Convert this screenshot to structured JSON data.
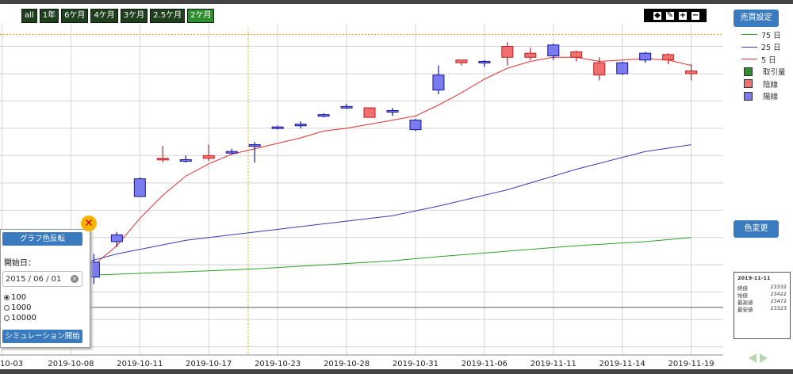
{
  "range_buttons": [
    "all",
    "1年",
    "6ケ月",
    "4ケ月",
    "3ケ月",
    "2.5ケ月",
    "2ケ月"
  ],
  "active_range": "2ケ月",
  "side_buttons": {
    "trade_settings": "売買設定",
    "color_change": "色変更"
  },
  "legend": [
    {
      "label": "75 日",
      "kind": "line",
      "color": "#2ca02c"
    },
    {
      "label": "25 日",
      "kind": "line",
      "color": "#3a3ab0"
    },
    {
      "label": "5 日",
      "kind": "line",
      "color": "#e03030"
    },
    {
      "label": "取引量",
      "kind": "box",
      "color": "#2e8b2e"
    },
    {
      "label": "陰線",
      "kind": "box",
      "color": "#f07070"
    },
    {
      "label": "陽線",
      "kind": "box",
      "color": "#7b7bf0"
    }
  ],
  "tooltip": {
    "date": "2019-11-11",
    "rows": [
      {
        "label": "終値",
        "value": "23332"
      },
      {
        "label": "始値",
        "value": "23422"
      },
      {
        "label": "最高値",
        "value": "23472"
      },
      {
        "label": "最安値",
        "value": "23323"
      }
    ]
  },
  "simulation_panel": {
    "flip_button": "グラフ色反転",
    "start_label": "開始日：",
    "start_date": "2015 / 06 / 01",
    "options": [
      "100",
      "1000",
      "10000"
    ],
    "selected_option": "100",
    "start_button": "シミュレーション開始"
  },
  "chart_data": {
    "type": "candlestick",
    "x_tick_labels": [
      "10-03",
      "2019-10-08",
      "2019-10-11",
      "2019-10-17",
      "2019-10-23",
      "2019-10-28",
      "2019-10-31",
      "2019-11-06",
      "2019-11-11",
      "2019-11-14",
      "2019-11-19"
    ],
    "candles": [
      {
        "i": 2,
        "open": 21760,
        "close": 21765,
        "high": 21780,
        "low": 21740,
        "kind": "yang"
      },
      {
        "i": 3,
        "open": 21610,
        "close": 21690,
        "high": 21700,
        "low": 21590,
        "kind": "yang"
      },
      {
        "i": 4,
        "open": 21610,
        "close": 21720,
        "high": 21780,
        "low": 21560,
        "kind": "yang"
      },
      {
        "i": 5,
        "open": 21870,
        "close": 21920,
        "high": 21940,
        "low": 21830,
        "kind": "yang"
      },
      {
        "i": 6,
        "open": 22200,
        "close": 22330,
        "high": 22340,
        "low": 22200,
        "kind": "yang"
      },
      {
        "i": 7,
        "open": 22480,
        "close": 22470,
        "high": 22570,
        "low": 22450,
        "kind": "yin"
      },
      {
        "i": 8,
        "open": 22460,
        "close": 22470,
        "high": 22500,
        "low": 22450,
        "kind": "yang"
      },
      {
        "i": 9,
        "open": 22500,
        "close": 22480,
        "high": 22580,
        "low": 22460,
        "kind": "yin"
      },
      {
        "i": 10,
        "open": 22520,
        "close": 22530,
        "high": 22550,
        "low": 22510,
        "kind": "yang"
      },
      {
        "i": 11,
        "open": 22570,
        "close": 22580,
        "high": 22600,
        "low": 22450,
        "kind": "yang"
      },
      {
        "i": 12,
        "open": 22700,
        "close": 22710,
        "high": 22720,
        "low": 22690,
        "kind": "yang"
      },
      {
        "i": 13,
        "open": 22720,
        "close": 22730,
        "high": 22750,
        "low": 22700,
        "kind": "yang"
      },
      {
        "i": 14,
        "open": 22790,
        "close": 22800,
        "high": 22810,
        "low": 22780,
        "kind": "yang"
      },
      {
        "i": 15,
        "open": 22850,
        "close": 22860,
        "high": 22880,
        "low": 22840,
        "kind": "yang"
      },
      {
        "i": 16,
        "open": 22850,
        "close": 22780,
        "high": 22850,
        "low": 22780,
        "kind": "yin"
      },
      {
        "i": 17,
        "open": 22830,
        "close": 22830,
        "high": 22850,
        "low": 22790,
        "kind": "yang"
      },
      {
        "i": 18,
        "open": 22690,
        "close": 22760,
        "high": 22770,
        "low": 22680,
        "kind": "yang"
      },
      {
        "i": 19,
        "open": 22980,
        "close": 23090,
        "high": 23160,
        "low": 22950,
        "kind": "yang"
      },
      {
        "i": 20,
        "open": 23200,
        "close": 23180,
        "high": 23200,
        "low": 23160,
        "kind": "yin"
      },
      {
        "i": 21,
        "open": 23180,
        "close": 23190,
        "high": 23200,
        "low": 23150,
        "kind": "yang"
      },
      {
        "i": 22,
        "open": 23300,
        "close": 23220,
        "high": 23330,
        "low": 23160,
        "kind": "yin"
      },
      {
        "i": 23,
        "open": 23250,
        "close": 23220,
        "high": 23290,
        "low": 23200,
        "kind": "yin"
      },
      {
        "i": 24,
        "open": 23230,
        "close": 23310,
        "high": 23320,
        "low": 23200,
        "kind": "yang"
      },
      {
        "i": 25,
        "open": 23260,
        "close": 23220,
        "high": 23270,
        "low": 23190,
        "kind": "yin"
      },
      {
        "i": 26,
        "open": 23180,
        "close": 23090,
        "high": 23220,
        "low": 23050,
        "kind": "yin"
      },
      {
        "i": 27,
        "open": 23100,
        "close": 23180,
        "high": 23190,
        "low": 23090,
        "kind": "yang"
      },
      {
        "i": 28,
        "open": 23200,
        "close": 23250,
        "high": 23260,
        "low": 23180,
        "kind": "yang"
      },
      {
        "i": 29,
        "open": 23240,
        "close": 23200,
        "high": 23250,
        "low": 23170,
        "kind": "yin"
      },
      {
        "i": 30,
        "open": 23120,
        "close": 23100,
        "high": 23170,
        "low": 23050,
        "kind": "yin"
      }
    ],
    "series": [
      {
        "name": "5 日",
        "color": "#e03030",
        "points": [
          [
            0,
            21860
          ],
          [
            1,
            21780
          ],
          [
            2,
            21700
          ],
          [
            3,
            21640
          ],
          [
            4,
            21700
          ],
          [
            5,
            21840
          ],
          [
            6,
            22040
          ],
          [
            7,
            22210
          ],
          [
            8,
            22350
          ],
          [
            9,
            22440
          ],
          [
            10,
            22510
          ],
          [
            11,
            22550
          ],
          [
            12,
            22590
          ],
          [
            13,
            22630
          ],
          [
            14,
            22680
          ],
          [
            15,
            22700
          ],
          [
            16,
            22730
          ],
          [
            17,
            22760
          ],
          [
            18,
            22790
          ],
          [
            19,
            22870
          ],
          [
            20,
            22960
          ],
          [
            21,
            23060
          ],
          [
            22,
            23140
          ],
          [
            23,
            23190
          ],
          [
            24,
            23220
          ],
          [
            25,
            23220
          ],
          [
            26,
            23190
          ],
          [
            27,
            23200
          ],
          [
            28,
            23210
          ],
          [
            29,
            23200
          ],
          [
            30,
            23160
          ]
        ]
      },
      {
        "name": "25 日",
        "color": "#3a3ab0",
        "points": [
          [
            3,
            21690
          ],
          [
            5,
            21780
          ],
          [
            8,
            21880
          ],
          [
            11,
            21940
          ],
          [
            14,
            22000
          ],
          [
            17,
            22060
          ],
          [
            19,
            22130
          ],
          [
            22,
            22250
          ],
          [
            25,
            22400
          ],
          [
            28,
            22530
          ],
          [
            30,
            22580
          ]
        ]
      },
      {
        "name": "75 日",
        "color": "#2ca02c",
        "points": [
          [
            3,
            21620
          ],
          [
            8,
            21650
          ],
          [
            11,
            21670
          ],
          [
            14,
            21700
          ],
          [
            17,
            21730
          ],
          [
            19,
            21760
          ],
          [
            22,
            21800
          ],
          [
            25,
            21840
          ],
          [
            28,
            21870
          ],
          [
            30,
            21900
          ]
        ]
      }
    ]
  }
}
